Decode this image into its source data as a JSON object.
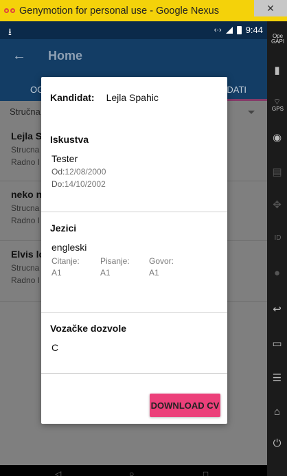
{
  "window": {
    "title": "Genymotion for personal use - Google Nexus",
    "close_glyph": "✕"
  },
  "status_bar": {
    "time": "9:44",
    "download_icon": "download-icon"
  },
  "app_bar": {
    "title": "Home",
    "back_icon": "arrow-left-icon"
  },
  "tabs": {
    "left_label": "OG",
    "right_label": "DATI"
  },
  "background": {
    "dropdown_value": "Stručna",
    "cards": [
      {
        "name": "Lejla S",
        "line1": "Strucna",
        "line2": "Radno I"
      },
      {
        "name": "neko n",
        "line1": "Strucna",
        "line2": "Radno I"
      },
      {
        "name": "Elvis lo",
        "line1": "Strucna",
        "line2": "Radno I"
      }
    ]
  },
  "dialog": {
    "kandidat_label": "Kandidat:",
    "kandidat_value": "Lejla Spahic",
    "iskustva": {
      "heading": "Iskustva",
      "position": "Tester",
      "od_label": "Od:",
      "od_value": "12/08/2000",
      "do_label": "Do:",
      "do_value": "14/10/2002"
    },
    "jezici": {
      "heading": "Jezici",
      "language": "engleski",
      "columns": [
        {
          "label": "Citanje:",
          "value": "A1"
        },
        {
          "label": "Pisanje:",
          "value": "A1"
        },
        {
          "label": "Govor:",
          "value": "A1"
        }
      ]
    },
    "vozacke": {
      "heading": "Vozačke dozvole",
      "value": "C"
    },
    "download_label": "DOWNLOAD CV"
  },
  "sidebar": {
    "top_text": "Ope GAPI",
    "gps_text": "GPS",
    "id_text": "ID"
  },
  "colors": {
    "titlebar": "#f4d20a",
    "appbar": "#133d65",
    "accent": "#ec407a",
    "scrim": "#7f7f7f"
  }
}
